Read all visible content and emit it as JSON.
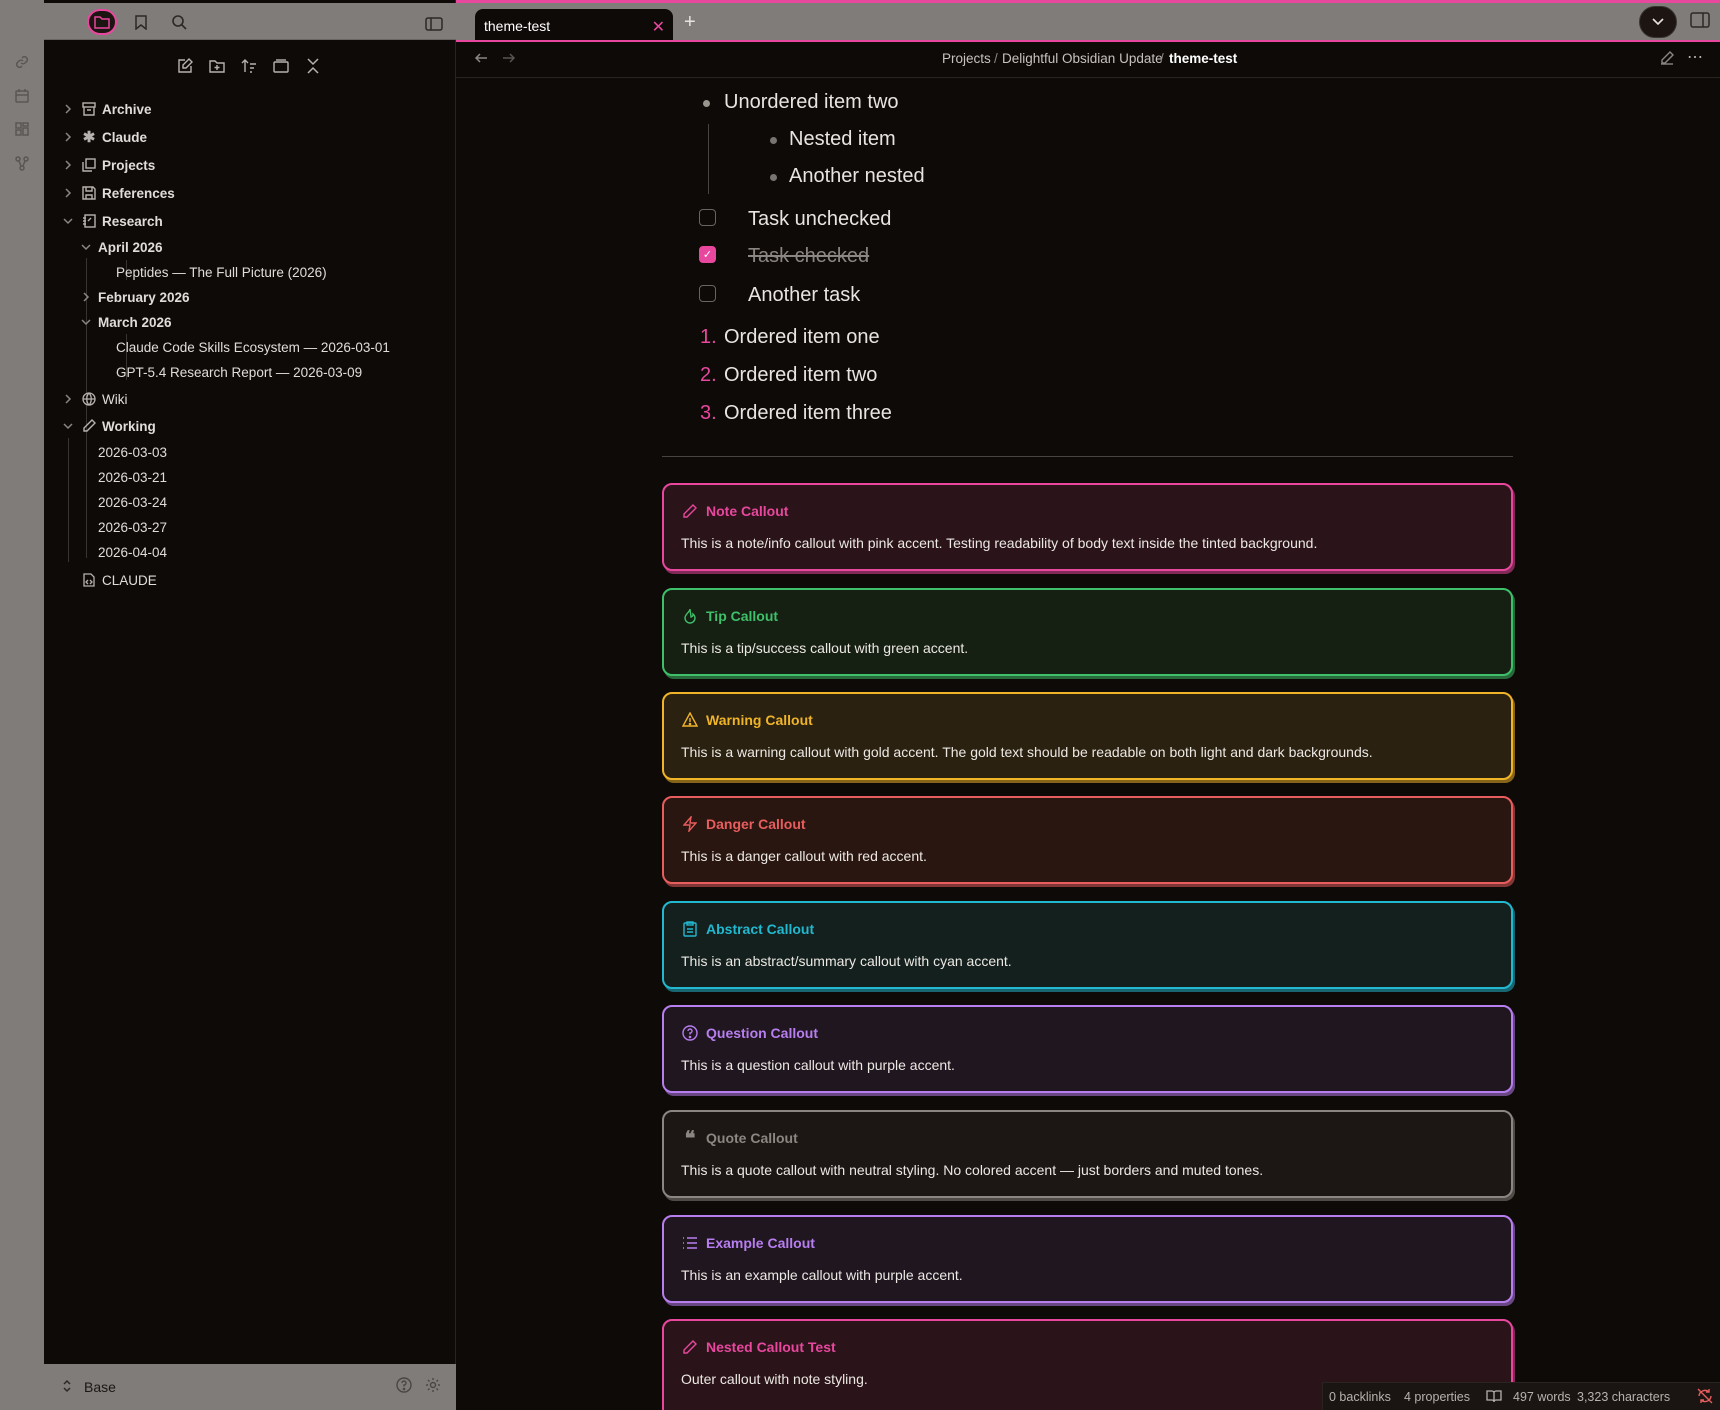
{
  "sidebar": {
    "tree": [
      {
        "label": "Archive"
      },
      {
        "label": "Claude"
      },
      {
        "label": "Projects"
      },
      {
        "label": "References"
      },
      {
        "label": "Research"
      },
      {
        "label": "April 2026"
      },
      {
        "label": "Peptides — The Full Picture (2026)"
      },
      {
        "label": "February 2026"
      },
      {
        "label": "March 2026"
      },
      {
        "label": "Claude Code Skills Ecosystem — 2026-03-01"
      },
      {
        "label": "GPT-5.4 Research Report — 2026-03-09"
      },
      {
        "label": "Wiki"
      },
      {
        "label": "Working"
      },
      {
        "label": "2026-03-03"
      },
      {
        "label": "2026-03-21"
      },
      {
        "label": "2026-03-24"
      },
      {
        "label": "2026-03-27"
      },
      {
        "label": "2026-04-04"
      },
      {
        "label": "CLAUDE"
      }
    ],
    "vault_name": "Base"
  },
  "tab": {
    "title": "theme-test"
  },
  "breadcrumb": {
    "p1": "Projects",
    "p2": "Delightful Obsidian Update",
    "current": "theme-test",
    "sep": "/"
  },
  "content": {
    "bullets": [
      "Unordered item two",
      "Nested item",
      "Another nested"
    ],
    "tasks": [
      "Task unchecked",
      "Task checked",
      "Another task"
    ],
    "ordered": [
      {
        "n": "1.",
        "text": "Ordered item one"
      },
      {
        "n": "2.",
        "text": "Ordered item two"
      },
      {
        "n": "3.",
        "text": "Ordered item three"
      }
    ],
    "callouts": [
      {
        "title": "Note Callout",
        "body": "This is a note/info callout with pink accent. Testing readability of body text inside the tinted background.",
        "color": "#e8479e",
        "bg": "#2a1419"
      },
      {
        "title": "Tip Callout",
        "body": "This is a tip/success callout with green accent.",
        "color": "#3fbf6a",
        "bg": "#162012"
      },
      {
        "title": "Warning Callout",
        "body": "This is a warning callout with gold accent. The gold text should be readable on both light and dark backgrounds.",
        "color": "#f0b429",
        "bg": "#2a2110"
      },
      {
        "title": "Danger Callout",
        "body": "This is a danger callout with red accent.",
        "color": "#e85d5d",
        "bg": "#2a1610"
      },
      {
        "title": "Abstract Callout",
        "body": "This is an abstract/summary callout with cyan accent.",
        "color": "#22b8cf",
        "bg": "#13201e"
      },
      {
        "title": "Question Callout",
        "body": "This is a question callout with purple accent.",
        "color": "#b77ef0",
        "bg": "#20161f"
      },
      {
        "title": "Quote Callout",
        "body": "This is a quote callout with neutral styling. No colored accent — just borders and muted tones.",
        "color": "#8c8682",
        "bg": "#1c1714"
      },
      {
        "title": "Example Callout",
        "body": "This is an example callout with purple accent.",
        "color": "#b77ef0",
        "bg": "#20161f"
      },
      {
        "title": "Nested Callout Test",
        "body": "Outer callout with note styling.",
        "color": "#e8479e",
        "bg": "#2a1419"
      }
    ]
  },
  "status": {
    "backlinks": "0 backlinks",
    "properties": "4 properties",
    "words": "497 words",
    "chars": "3,323 characters"
  },
  "icons": {
    "note": "pencil-icon",
    "tip": "flame-icon",
    "warning": "alert-triangle-icon",
    "danger": "zap-icon",
    "abstract": "clipboard-icon",
    "question": "help-circle-icon",
    "quote": "quote-icon",
    "example": "list-icon"
  }
}
